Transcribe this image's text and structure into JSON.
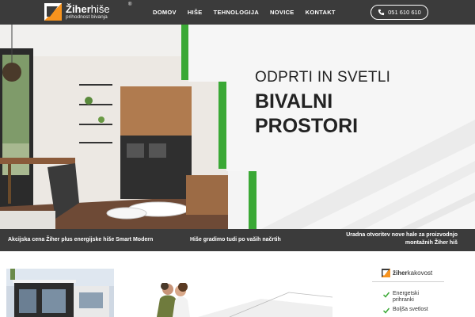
{
  "header": {
    "logo": {
      "brand_bold": "Žiher",
      "brand_light": "hiše",
      "tagline": "prihodnost bivanja",
      "reg": "®"
    },
    "nav": [
      {
        "label": "DOMOV"
      },
      {
        "label": "HIŠE"
      },
      {
        "label": "TEHNOLOGIJA"
      },
      {
        "label": "NOVICE"
      },
      {
        "label": "KONTAKT"
      }
    ],
    "phone": "051 610 610"
  },
  "hero": {
    "line1": "ODPRTI IN SVETLI",
    "line2": "BIVALNI",
    "line3": "PROSTORI"
  },
  "ticker": [
    {
      "text": "Akcijska cena Žiher plus energijske hiše Smart Modern"
    },
    {
      "text": "Hiše gradimo tudi po vaših načrtih"
    },
    {
      "line1": "Uradna otvoritev nove hale za proizvodnjo",
      "line2": "montažnih Žiher hiš"
    }
  ],
  "kakovost": {
    "title_bold": "žiher",
    "title_light": "kakovost",
    "items": [
      {
        "line1": "Energetski",
        "line2": "prihranki"
      },
      {
        "line1": "Boljša svetlost",
        "line2": ""
      }
    ]
  },
  "colors": {
    "header_bg": "#3b3b3b",
    "accent_green": "#3aa835",
    "logo_orange": "#f7931e"
  }
}
